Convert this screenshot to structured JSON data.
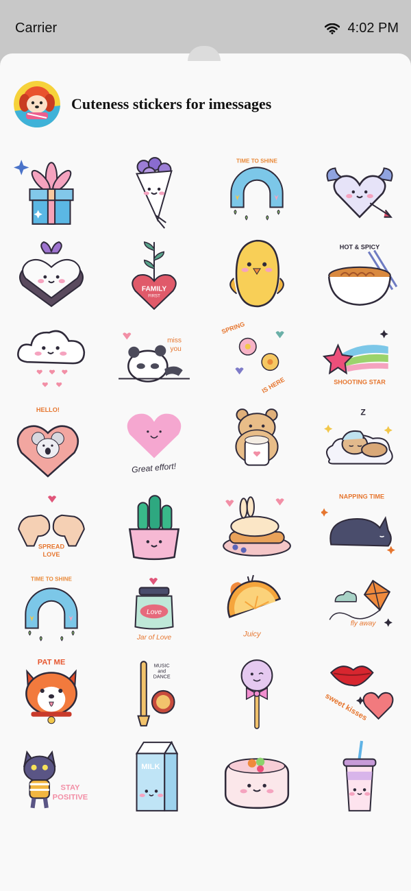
{
  "status_bar": {
    "carrier": "Carrier",
    "time": "4:02 PM"
  },
  "header": {
    "title": "Cuteness stickers for imessages"
  },
  "stickers": [
    {
      "name": "gift-box",
      "text": []
    },
    {
      "name": "flower-bouquet",
      "text": []
    },
    {
      "name": "rainbow",
      "text": [
        "TIME TO SHINE"
      ]
    },
    {
      "name": "heart-with-wings",
      "text": []
    },
    {
      "name": "heart-cake",
      "text": []
    },
    {
      "name": "family-heart-plant",
      "text": [
        "FAMILY",
        "FIRST"
      ]
    },
    {
      "name": "yellow-bird",
      "text": []
    },
    {
      "name": "ramen-bowl",
      "text": [
        "HOT & SPICY"
      ]
    },
    {
      "name": "rain-cloud",
      "text": []
    },
    {
      "name": "panda-miss-you",
      "text": [
        "miss",
        "you"
      ]
    },
    {
      "name": "spring-flowers",
      "text": [
        "SPRING",
        "IS HERE"
      ]
    },
    {
      "name": "shooting-star",
      "text": [
        "SHOOTING STAR"
      ]
    },
    {
      "name": "koala-heart",
      "text": [
        "HELLO!"
      ]
    },
    {
      "name": "pink-heart",
      "text": [
        "Great effort!"
      ]
    },
    {
      "name": "bear-cocoa",
      "text": []
    },
    {
      "name": "sleeping-bear-cloud",
      "text": [
        "Z"
      ]
    },
    {
      "name": "heart-hands",
      "text": [
        "SPREAD",
        "LOVE"
      ]
    },
    {
      "name": "cactus-pot",
      "text": []
    },
    {
      "name": "bunny-pancakes",
      "text": []
    },
    {
      "name": "napping-cat",
      "text": [
        "NAPPING TIME"
      ]
    },
    {
      "name": "rainbow-2",
      "text": [
        "TIME TO SHINE"
      ]
    },
    {
      "name": "jar-of-love",
      "text": [
        "Love",
        "Jar of Love"
      ]
    },
    {
      "name": "orange-slice",
      "text": [
        "Juicy"
      ]
    },
    {
      "name": "kite",
      "text": [
        "fly away"
      ]
    },
    {
      "name": "dog-pat-me",
      "text": [
        "PAT ME"
      ]
    },
    {
      "name": "flute-tambourine",
      "text": [
        "MUSIC",
        "and",
        "DANCE"
      ]
    },
    {
      "name": "lollipop",
      "text": []
    },
    {
      "name": "lips-sweet-kisses",
      "text": [
        "sweet kisses"
      ]
    },
    {
      "name": "cat-stay-positive",
      "text": [
        "STAY",
        "POSITIVE"
      ]
    },
    {
      "name": "milk-carton",
      "text": [
        "MILK"
      ]
    },
    {
      "name": "sushi-cake",
      "text": []
    },
    {
      "name": "bubble-tea",
      "text": []
    }
  ],
  "colors": {
    "accent_pink": "#f7a6bf",
    "accent_blue": "#7cc7e8",
    "accent_orange": "#f08a3c",
    "outline": "#2f2a3a"
  }
}
